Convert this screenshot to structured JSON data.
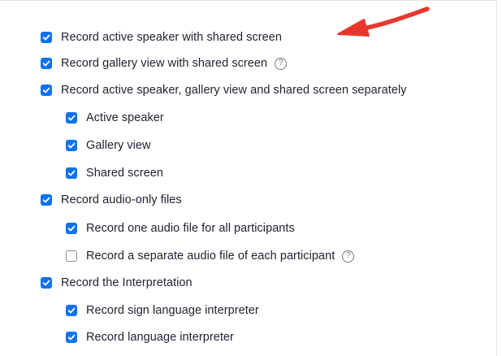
{
  "settings": {
    "items": [
      {
        "label": "Record active speaker with shared screen",
        "checked": true,
        "help": false
      },
      {
        "label": "Record gallery view with shared screen",
        "checked": true,
        "help": true
      },
      {
        "label": "Record active speaker, gallery view and shared screen separately",
        "checked": true,
        "help": false
      },
      {
        "label": "Active speaker",
        "checked": true,
        "help": false
      },
      {
        "label": "Gallery view",
        "checked": true,
        "help": false
      },
      {
        "label": "Shared screen",
        "checked": true,
        "help": false
      },
      {
        "label": "Record audio-only files",
        "checked": true,
        "help": false
      },
      {
        "label": "Record one audio file for all participants",
        "checked": true,
        "help": false
      },
      {
        "label": "Record a separate audio file of each participant",
        "checked": false,
        "help": true
      },
      {
        "label": "Record the Interpretation",
        "checked": true,
        "help": false
      },
      {
        "label": "Record sign language interpreter",
        "checked": true,
        "help": false
      },
      {
        "label": "Record language interpreter",
        "checked": true,
        "help": false
      }
    ],
    "help_glyph": "?"
  },
  "annotation": {
    "icon": "red-arrow-icon",
    "color": "#e8362d"
  },
  "colors": {
    "checkbox_checked": "#0e72ed",
    "text": "#232333",
    "help_icon": "#747487"
  }
}
